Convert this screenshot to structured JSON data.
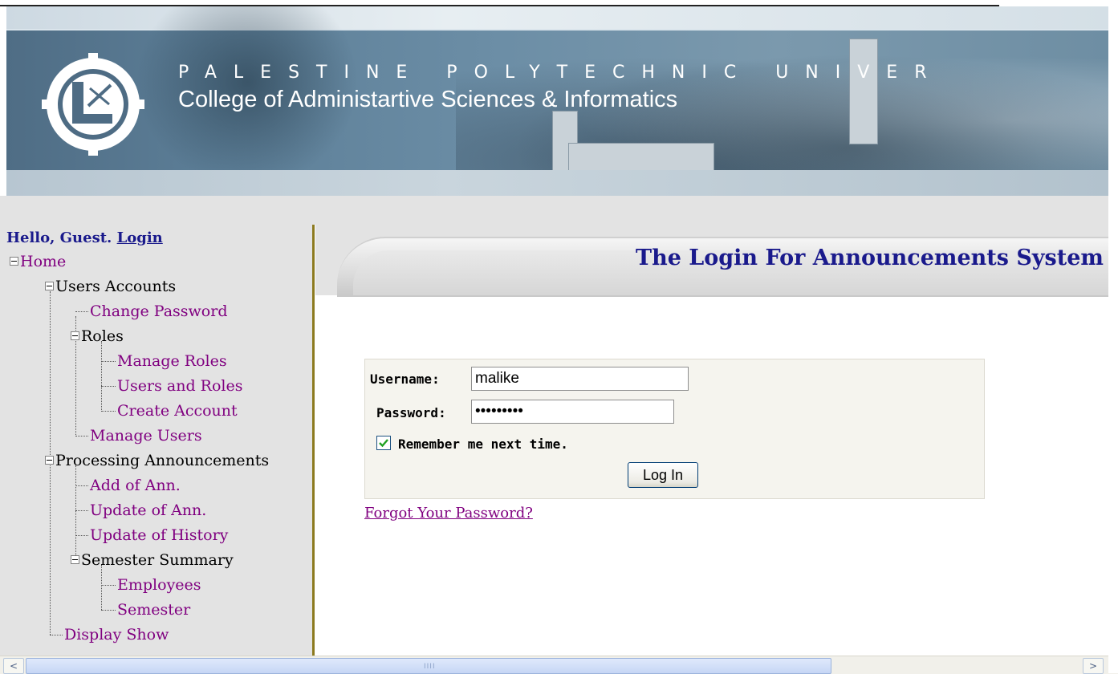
{
  "header": {
    "university": "PALESTINE POLYTECHNIC UNIVER",
    "college": "College of Administartive Sciences & Informatics"
  },
  "sidebar": {
    "greeting": "Hello, Guest.",
    "login_link": "Login",
    "tree": {
      "home": "Home",
      "users_accounts": "Users Accounts",
      "change_password": "Change Password",
      "roles": "Roles",
      "manage_roles": "Manage Roles",
      "users_and_roles": "Users and Roles",
      "create_account": "Create Account",
      "manage_users": "Manage Users",
      "processing_announcements": "Processing Announcements",
      "add_ann": "Add of Ann.",
      "update_ann": "Update of Ann.",
      "update_history": "Update of History",
      "semester_summary": "Semester Summary",
      "employees": "Employees",
      "semester": "Semester",
      "display_show": "Display Show"
    }
  },
  "main": {
    "title": "The Login For Announcements System",
    "login": {
      "username_label": "Username:",
      "username_value": "malike",
      "password_label": "Password:",
      "password_value": "malike123",
      "remember_label": "Remember me next time.",
      "remember_checked": true,
      "button_label": "Log In",
      "forgot_link": "Forgot Your Password?"
    }
  },
  "scrollbar": {
    "left_arrow": "<",
    "right_arrow": ">",
    "grip": "IIII"
  }
}
